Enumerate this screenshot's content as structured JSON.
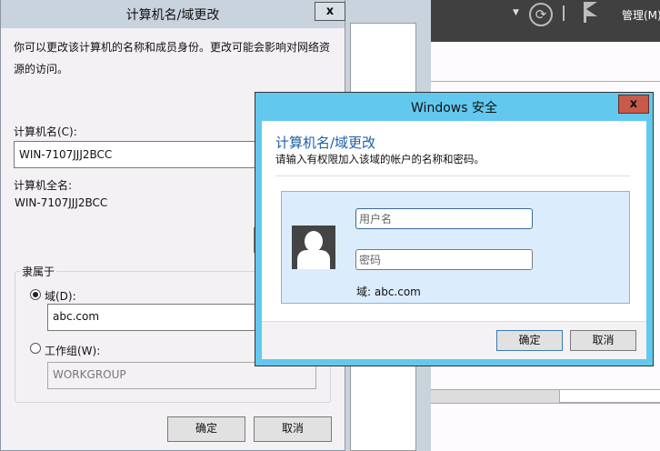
{
  "back_dialog": {
    "title": "计算机名/域更改",
    "close": "x",
    "description": "你可以更改该计算机的名称和成员身份。更改可能会影响对网络资源的访问。",
    "computer_name_label": "计算机名(C):",
    "computer_name_value": "WIN-7107JJJ2BCC",
    "full_name_label": "计算机全名:",
    "full_name_value": "WIN-7107JJJ2BCC",
    "member_of_label": "隶属于",
    "domain_label": "域(D):",
    "domain_value": "abc.com",
    "workgroup_label": "工作组(W):",
    "workgroup_value": "WORKGROUP",
    "ok": "确定",
    "cancel": "取消"
  },
  "server_manager": {
    "manage_menu": "管理(M)"
  },
  "security_dialog": {
    "title": "Windows 安全",
    "close": "x",
    "heading": "计算机名/域更改",
    "subheading": "请输入有权限加入该域的帐户的名称和密码。",
    "username_placeholder": "用户名",
    "password_placeholder": "密码",
    "domain_text": "域: abc.com",
    "ok": "确定",
    "cancel": "取消"
  }
}
